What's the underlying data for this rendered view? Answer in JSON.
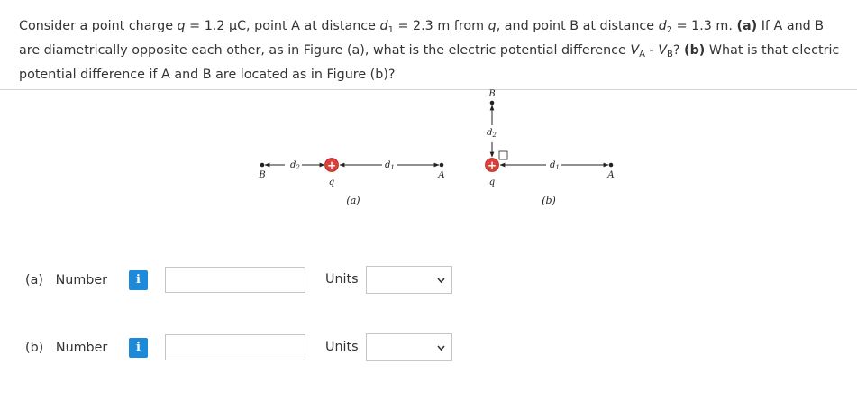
{
  "question": {
    "segments": [
      {
        "t": "Consider a point charge "
      },
      {
        "t": "q",
        "i": true
      },
      {
        "t": " = 1.2 μC, point A at distance "
      },
      {
        "t": "d",
        "i": true
      },
      {
        "t": "1",
        "sub": true
      },
      {
        "t": " = 2.3 m from "
      },
      {
        "t": "q",
        "i": true
      },
      {
        "t": ", and point B at distance "
      },
      {
        "t": "d",
        "i": true
      },
      {
        "t": "2",
        "sub": true
      },
      {
        "t": " = 1.3 m. "
      },
      {
        "t": "(a)",
        "b": true
      },
      {
        "t": " If A and B are diametrically opposite each other, as in Figure (a), what is the electric potential difference "
      },
      {
        "t": "V",
        "i": true
      },
      {
        "t": "A",
        "sub": true
      },
      {
        "t": " - "
      },
      {
        "t": "V",
        "i": true
      },
      {
        "t": "B",
        "sub": true
      },
      {
        "t": "? "
      },
      {
        "t": "(b)",
        "b": true
      },
      {
        "t": " What is that electric potential difference if A and B are located as in Figure (b)?"
      }
    ]
  },
  "figure": {
    "a": {
      "B": "B",
      "d2": "d",
      "d2_sub": "2",
      "q": "q",
      "d1": "d",
      "d1_sub": "1",
      "A": "A",
      "caption": "(a)"
    },
    "b": {
      "B": "B",
      "d2": "d",
      "d2_sub": "2",
      "q": "q",
      "d1": "d",
      "d1_sub": "1",
      "A": "A",
      "caption": "(b)"
    },
    "plus": "+"
  },
  "answers": [
    {
      "label_letter": "(a)",
      "label_word": "Number",
      "info": "i",
      "value": "",
      "units_label": "Units",
      "units_value": ""
    },
    {
      "label_letter": "(b)",
      "label_word": "Number",
      "info": "i",
      "value": "",
      "units_label": "Units",
      "units_value": ""
    }
  ],
  "colors": {
    "info_button": "#1c8ad8",
    "charge_fill": "#d9413a"
  }
}
